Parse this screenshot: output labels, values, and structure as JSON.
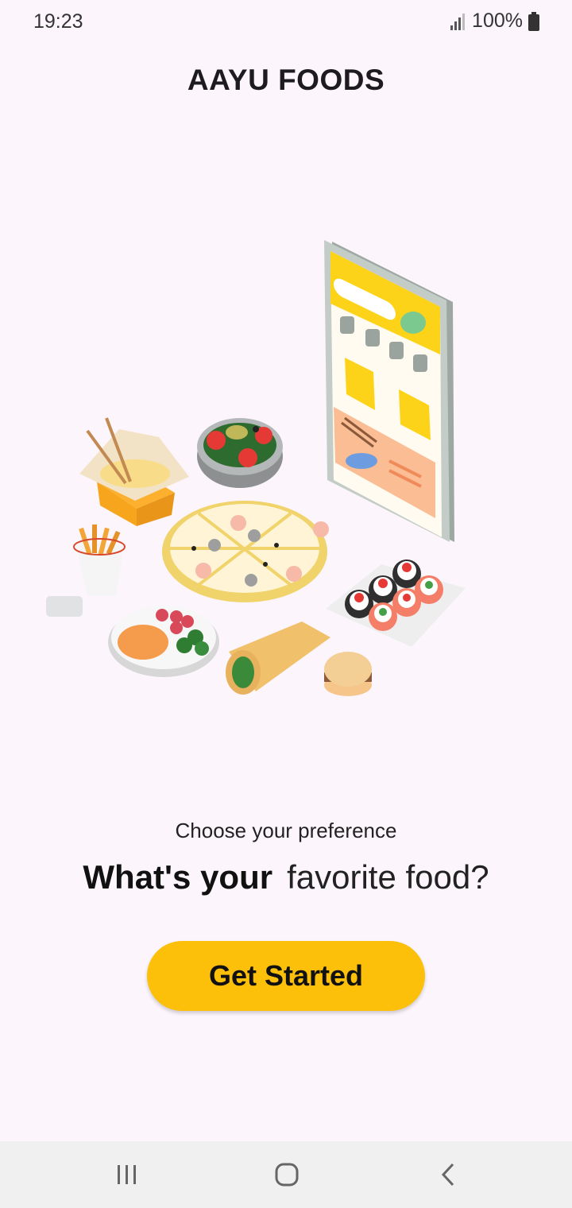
{
  "status": {
    "time": "19:23",
    "battery": "100%"
  },
  "app": {
    "title": "AAYU FOODS"
  },
  "hero": {
    "icon": "food-delivery-illustration"
  },
  "content": {
    "subtitle": "Choose your preference",
    "headline_bold": "What's your",
    "headline_light": "favorite food?"
  },
  "cta": {
    "label": "Get Started",
    "color": "#fcc00a"
  },
  "nav": {
    "recents_icon": "recents-icon",
    "home_icon": "home-icon",
    "back_icon": "back-icon"
  }
}
